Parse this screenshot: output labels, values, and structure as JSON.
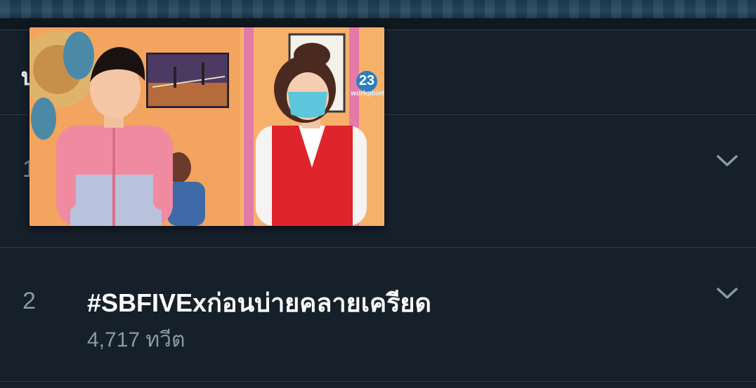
{
  "header": {
    "title": "บ"
  },
  "trends": [
    {
      "rank": "1",
      "title": "",
      "count": ""
    },
    {
      "rank": "2",
      "title": "#SBFIVExก่อนบ่ายคลายเครียด",
      "count": "4,717 ทวีต"
    }
  ],
  "video": {
    "channel_number": "23",
    "channel_name": "workpoint"
  },
  "icons": {
    "chevron": "chevron-down-icon"
  },
  "colors": {
    "background": "#16202b",
    "divider": "#2f3b47",
    "text_primary": "#ffffff",
    "text_secondary": "#8b98a5",
    "accent": "#1d9bf0"
  }
}
